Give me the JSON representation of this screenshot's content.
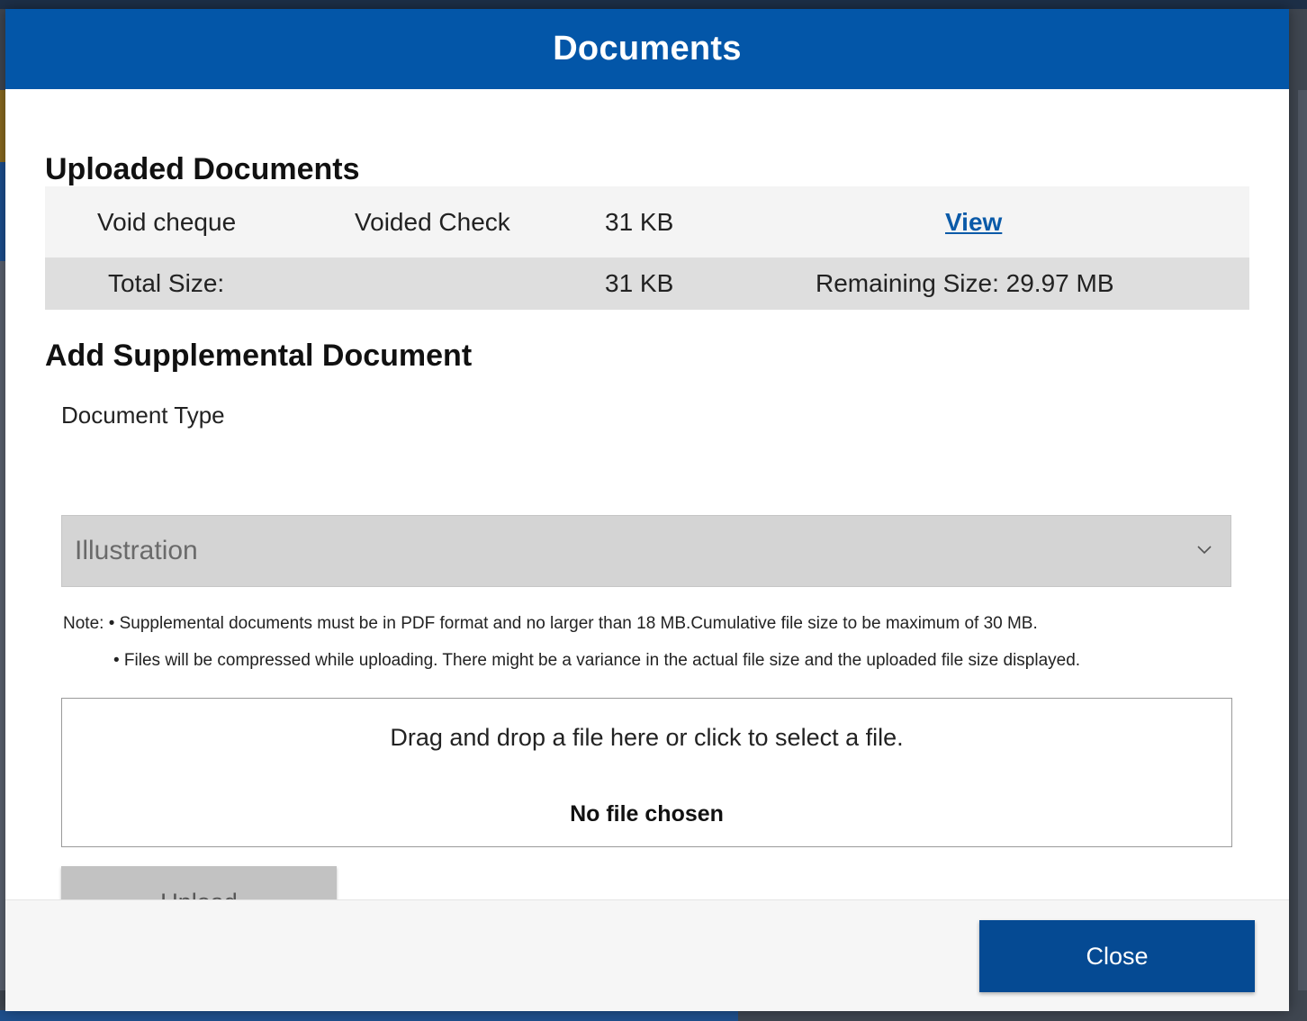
{
  "modal": {
    "title": "Documents"
  },
  "uploaded": {
    "heading": "Uploaded Documents",
    "rows": [
      {
        "name": "Void cheque",
        "type": "Voided Check",
        "size": "31 KB",
        "action": "View"
      }
    ],
    "total": {
      "label": "Total Size:",
      "size": "31 KB",
      "remaining": "Remaining Size: 29.97 MB"
    }
  },
  "supplemental": {
    "heading": "Add Supplemental Document",
    "document_type_label": "Document Type",
    "document_type_value": "Illustration",
    "note_line1": "Note: • Supplemental documents must be in PDF format and no larger than 18 MB.Cumulative file size to be maximum of 30 MB.",
    "note_line2": "• Files will be compressed while uploading. There might be a variance in the actual file size and the uploaded file size displayed.",
    "dropzone_text": "Drag and drop a file here or click to select a file.",
    "file_status": "No file chosen",
    "upload_label": "Upload"
  },
  "footer": {
    "close_label": "Close"
  },
  "colors": {
    "header": "#0356a8",
    "close_button": "#054a93",
    "link": "#0a5aa8"
  },
  "icons": {
    "select_chevron": "chevron-down-icon"
  }
}
